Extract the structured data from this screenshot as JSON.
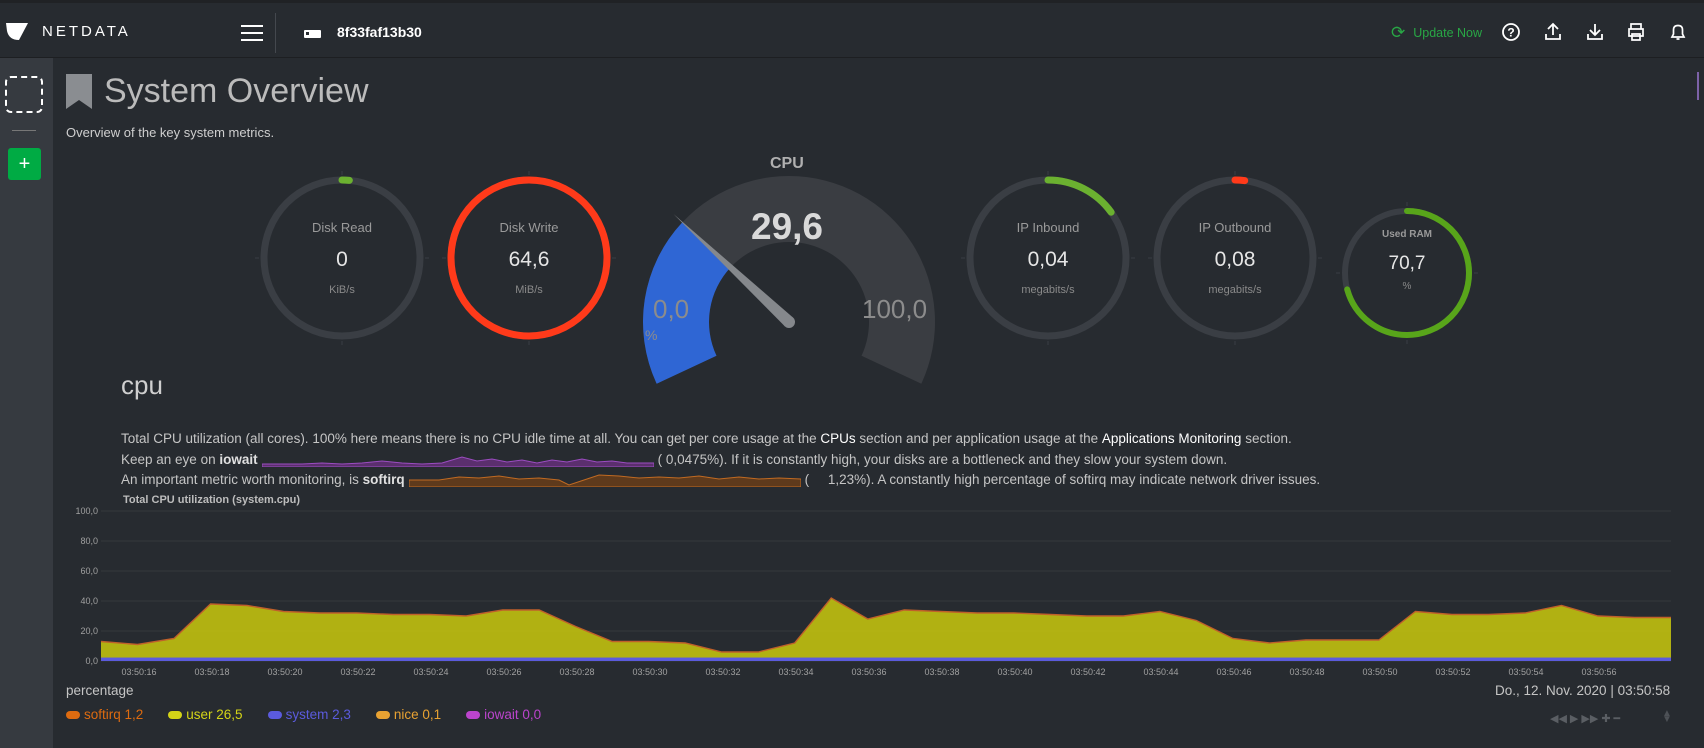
{
  "brand": "NETDATA",
  "hostname": "8f33faf13b30",
  "toolbar": {
    "update_label": "Update Now"
  },
  "page": {
    "title": "System Overview",
    "subtitle": "Overview of the key system metrics."
  },
  "gauges": [
    {
      "title": "Disk Read",
      "value": "0",
      "unit": "KiB/s",
      "color": "#6bb130",
      "fraction": 0.0
    },
    {
      "title": "Disk Write",
      "value": "64,6",
      "unit": "MiB/s",
      "color": "#ff3a1a",
      "fraction": 1.0
    },
    {
      "title": "IP Inbound",
      "value": "0,04",
      "unit": "megabits/s",
      "color": "#6bb130",
      "fraction": 0.15
    },
    {
      "title": "IP Outbound",
      "value": "0,08",
      "unit": "megabits/s",
      "color": "#ff3a1a",
      "fraction": 0.02
    },
    {
      "title": "Used RAM",
      "value": "70,7",
      "unit": "%",
      "color": "#58a51a",
      "fraction": 0.707
    }
  ],
  "cpu_gauge": {
    "title": "CPU",
    "value": "29,6",
    "min": "0,0",
    "max": "100,0",
    "unit": "%",
    "color": "#2f66d4",
    "fraction": 0.296
  },
  "section": {
    "title": "cpu",
    "line1_a": "Total CPU utilization (all cores). 100% here means there is no CPU idle time at all. You can get per core usage at the",
    "link_cpus": "CPUs",
    "line1_b": "section and per application usage at the",
    "link_apps": "Applications Monitoring",
    "line1_c": "section.",
    "line2_a": "Keep an eye on",
    "line2_b": "iowait",
    "line2_c": "(",
    "line2_d": "0,0475%). If it is constantly high, your disks are a bottleneck and they slow your system down.",
    "line3_a": "An important metric worth monitoring, is",
    "line3_b": "softirq",
    "line3_c": "(",
    "line3_d": "1,23%). A constantly high percentage of softirq may indicate network driver issues."
  },
  "chart_data": {
    "type": "area",
    "title": "Total CPU utilization (system.cpu)",
    "ylabel": "percentage",
    "ylim": [
      0,
      100
    ],
    "yticks": [
      "100,0",
      "80,0",
      "60,0",
      "40,0",
      "20,0",
      "0,0"
    ],
    "xticks": [
      "03:50:16",
      "03:50:18",
      "03:50:20",
      "03:50:22",
      "03:50:24",
      "03:50:26",
      "03:50:28",
      "03:50:30",
      "03:50:32",
      "03:50:34",
      "03:50:36",
      "03:50:38",
      "03:50:40",
      "03:50:42",
      "03:50:44",
      "03:50:46",
      "03:50:48",
      "03:50:50",
      "03:50:52",
      "03:50:54",
      "03:50:56"
    ],
    "total": [
      13,
      11,
      15,
      38,
      37,
      33,
      32,
      32,
      31,
      31,
      30,
      34,
      34,
      23,
      13,
      13,
      12,
      6,
      6,
      12,
      42,
      28,
      34,
      33,
      32,
      32,
      31,
      30,
      30,
      33,
      27,
      15,
      12,
      14,
      14,
      14,
      33,
      31,
      31,
      32,
      37,
      30,
      29,
      29
    ],
    "series": [
      {
        "name": "softirq",
        "value": "1,2",
        "color": "#dd6b10"
      },
      {
        "name": "user",
        "value": "26,5",
        "color": "#d4d417"
      },
      {
        "name": "system",
        "value": "2,3",
        "color": "#5b5bdd"
      },
      {
        "name": "nice",
        "value": "0,1",
        "color": "#e8a232"
      },
      {
        "name": "iowait",
        "value": "0,0",
        "color": "#bb44cc"
      }
    ],
    "datetime": "Do., 12. Nov. 2020 | 03:50:58"
  }
}
